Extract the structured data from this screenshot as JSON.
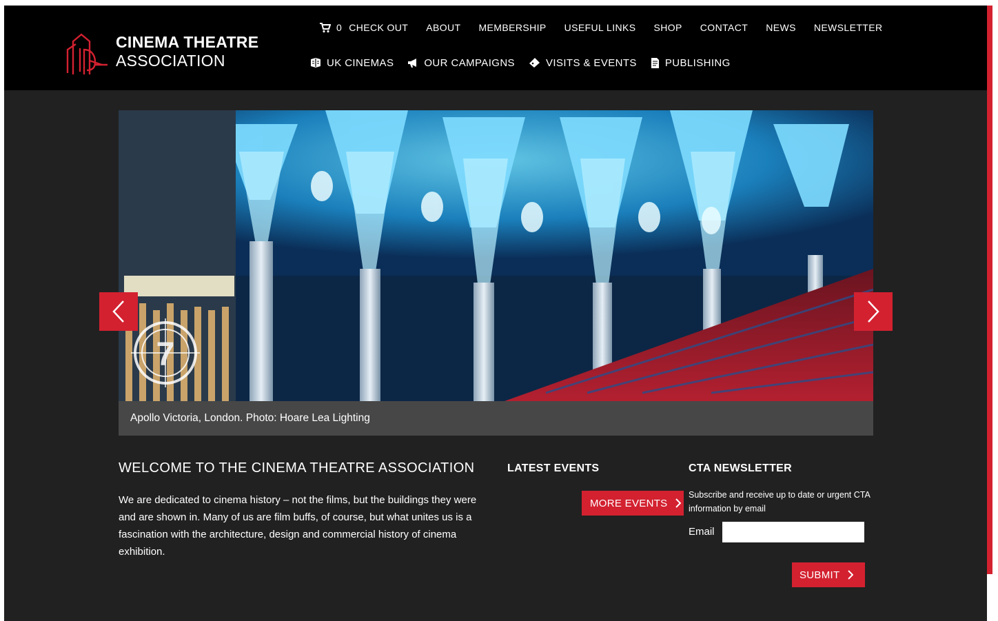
{
  "brand": {
    "name_line1": "CINEMA THEATRE",
    "name_line2": "ASSOCIATION",
    "accent_color": "#d32130"
  },
  "nav_top": {
    "cart_count": "0",
    "items": [
      "CHECK OUT",
      "ABOUT",
      "MEMBERSHIP",
      "USEFUL LINKS",
      "SHOP",
      "CONTACT",
      "NEWS",
      "NEWSLETTER"
    ]
  },
  "nav_main": {
    "items": [
      {
        "label": "UK CINEMAS",
        "icon": "book-icon"
      },
      {
        "label": "OUR CAMPAIGNS",
        "icon": "megaphone-icon"
      },
      {
        "label": "VISITS & EVENTS",
        "icon": "ticket-icon"
      },
      {
        "label": "PUBLISHING",
        "icon": "document-icon"
      }
    ]
  },
  "slider": {
    "caption": "Apollo Victoria, London. Photo: Hoare Lea Lighting",
    "badge_number": "7"
  },
  "welcome": {
    "title": "WELCOME TO THE CINEMA THEATRE ASSOCIATION",
    "body": "We are dedicated to cinema history – not the films, but the buildings they were and are shown in. Many of us are film buffs, of course, but what unites us is a fascination with the architecture, design and commercial history of cinema exhibition."
  },
  "events": {
    "title": "LATEST EVENTS",
    "more_label": "MORE EVENTS"
  },
  "newsletter": {
    "title": "CTA NEWSLETTER",
    "description": "Subscribe and receive up to date or urgent CTA information by email",
    "email_label": "Email",
    "email_value": "",
    "submit_label": "SUBMIT"
  }
}
